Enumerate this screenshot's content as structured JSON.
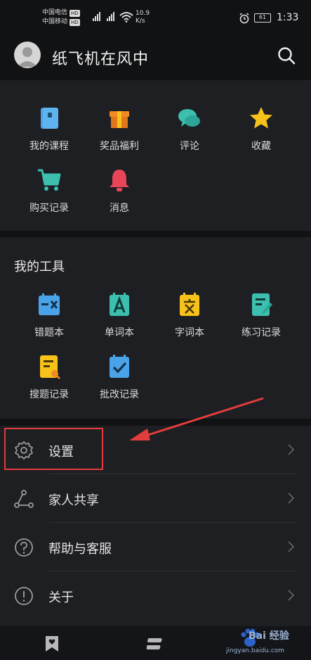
{
  "status_bar": {
    "carrier1": "中国电信",
    "carrier2": "中国移动",
    "hd": "HD",
    "net": "4G",
    "speed_value": "10.9",
    "speed_unit": "K/s",
    "battery": "61",
    "time": "1:33"
  },
  "header": {
    "username": "纸飞机在风中"
  },
  "services": {
    "items": [
      {
        "label": "我的课程",
        "icon": "book-icon",
        "color": "#4aa3e8"
      },
      {
        "label": "奖品福利",
        "icon": "gift-icon",
        "color": "#f08a24"
      },
      {
        "label": "评论",
        "icon": "chat-icon",
        "color": "#3dbfb0"
      },
      {
        "label": "收藏",
        "icon": "star-icon",
        "color": "#f7c21a"
      },
      {
        "label": "购买记录",
        "icon": "cart-icon",
        "color": "#3dbfb0"
      },
      {
        "label": "消息",
        "icon": "bell-icon",
        "color": "#e8445a"
      }
    ]
  },
  "tools": {
    "title": "我的工具",
    "items": [
      {
        "label": "错题本",
        "icon": "wrong-book-icon",
        "color": "#4aa3e8"
      },
      {
        "label": "单词本",
        "icon": "word-book-icon",
        "color": "#3dbfb0"
      },
      {
        "label": "字词本",
        "icon": "char-book-icon",
        "color": "#f7c21a"
      },
      {
        "label": "练习记录",
        "icon": "practice-icon",
        "color": "#3dbfb0"
      },
      {
        "label": "搜题记录",
        "icon": "search-record-icon",
        "color": "#f7c21a"
      },
      {
        "label": "批改记录",
        "icon": "check-record-icon",
        "color": "#4aa3e8"
      }
    ]
  },
  "menu": {
    "items": [
      {
        "label": "设置",
        "icon": "gear-icon"
      },
      {
        "label": "家人共享",
        "icon": "share-icon"
      },
      {
        "label": "帮助与客服",
        "icon": "help-icon"
      },
      {
        "label": "关于",
        "icon": "info-icon"
      }
    ]
  },
  "watermark": {
    "brand": "Bai 经验",
    "url": "jingyan.baidu.com"
  },
  "colors": {
    "background": "#111214",
    "card": "#1e1f22",
    "highlight": "#e33c3c"
  }
}
